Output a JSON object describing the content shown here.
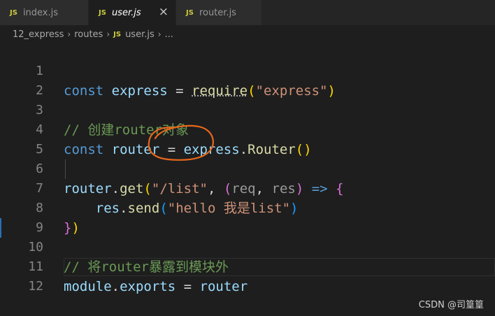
{
  "tabs": [
    {
      "icon": "JS",
      "label": "index.js"
    },
    {
      "icon": "JS",
      "label": "user.js",
      "close": "×"
    },
    {
      "icon": "JS",
      "label": "router.js"
    }
  ],
  "breadcrumb": {
    "folder1": "12_express",
    "folder2": "routes",
    "file_icon": "JS",
    "file": "user.js",
    "more": "...",
    "separator": "›"
  },
  "line_numbers": [
    "1",
    "2",
    "3",
    "4",
    "5",
    "6",
    "7",
    "8",
    "9",
    "10",
    "11",
    "12"
  ],
  "code": {
    "l1": {
      "kw": "const",
      "a": " express ",
      "eq": "= ",
      "fn": "require",
      "p1o": "(",
      "str": "\"express\"",
      "p1c": ")"
    },
    "l3": {
      "comment": "// 创建router对象"
    },
    "l4": {
      "kw": "const",
      "a": " router ",
      "eq": "= ",
      "obj": "express",
      "dot": ".",
      "fn": "Router",
      "po": "(",
      "pc": ")"
    },
    "l6": {
      "obj": "router",
      "dot": ".",
      "fn": "get",
      "po": "(",
      "str": "\"/list\"",
      "comma": ", ",
      "p2o": "(",
      "a1": "req",
      "c2": ", ",
      "a2": "res",
      "p2c": ")",
      "arrow": " => ",
      "brace": "{"
    },
    "l7": {
      "indent": "    ",
      "obj": "res",
      "dot": ".",
      "fn": "send",
      "po": "(",
      "str": "\"hello 我是list\"",
      "pc": ")"
    },
    "l8": {
      "brace": "}",
      "pc": ")"
    },
    "l10": {
      "comment": "// 将router暴露到模块外"
    },
    "l11": {
      "a": "module",
      "dot": ".",
      "b": "exports",
      "eq": " = ",
      "c": "router"
    }
  },
  "watermark": "CSDN @司篁篁",
  "colors": {
    "keyword": "#569cd6",
    "string": "#ce9178",
    "comment": "#6a9955",
    "annotation": "#e8681a"
  }
}
